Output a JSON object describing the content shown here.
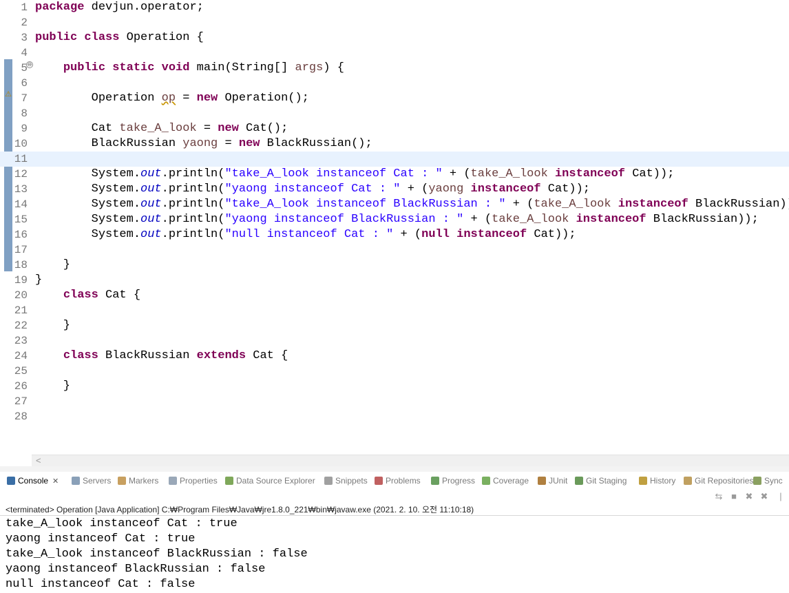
{
  "editor": {
    "lines": [
      {
        "n": "1",
        "html": "<span class=\"kw\">package</span> devjun.operator;"
      },
      {
        "n": "2",
        "html": ""
      },
      {
        "n": "3",
        "html": "<span class=\"kw\">public</span> <span class=\"kw\">class</span> Operation {"
      },
      {
        "n": "4",
        "html": ""
      },
      {
        "n": "5",
        "html": "    <span class=\"kw\">public</span> <span class=\"kw\">static</span> <span class=\"kw\">void</span> main(String[] <span class=\"var\">args</span>) {"
      },
      {
        "n": "6",
        "html": ""
      },
      {
        "n": "7",
        "html": "        Operation <span class=\"var warnu\">op</span> = <span class=\"kw\">new</span> Operation();"
      },
      {
        "n": "8",
        "html": ""
      },
      {
        "n": "9",
        "html": "        Cat <span class=\"var\">take_A_look</span> = <span class=\"kw\">new</span> Cat();"
      },
      {
        "n": "10",
        "html": "        BlackRussian <span class=\"var\">yaong</span> = <span class=\"kw\">new</span> BlackRussian();"
      },
      {
        "n": "11",
        "html": ""
      },
      {
        "n": "12",
        "html": "        System.<span class=\"fld\">out</span>.println(<span class=\"str\">\"take_A_look instanceof Cat : \"</span> + (<span class=\"var\">take_A_look</span> <span class=\"kw\">instanceof</span> Cat));"
      },
      {
        "n": "13",
        "html": "        System.<span class=\"fld\">out</span>.println(<span class=\"str\">\"yaong instanceof Cat : \"</span> + (<span class=\"var\">yaong</span> <span class=\"kw\">instanceof</span> Cat));"
      },
      {
        "n": "14",
        "html": "        System.<span class=\"fld\">out</span>.println(<span class=\"str\">\"take_A_look instanceof BlackRussian : \"</span> + (<span class=\"var\">take_A_look</span> <span class=\"kw\">instanceof</span> BlackRussian));"
      },
      {
        "n": "15",
        "html": "        System.<span class=\"fld\">out</span>.println(<span class=\"str\">\"yaong instanceof BlackRussian : \"</span> + (<span class=\"var\">take_A_look</span> <span class=\"kw\">instanceof</span> BlackRussian));"
      },
      {
        "n": "16",
        "html": "        System.<span class=\"fld\">out</span>.println(<span class=\"str\">\"null instanceof Cat : \"</span> + (<span class=\"kw\">null</span> <span class=\"kw\">instanceof</span> Cat));"
      },
      {
        "n": "17",
        "html": ""
      },
      {
        "n": "18",
        "html": "    }"
      },
      {
        "n": "19",
        "html": "}"
      },
      {
        "n": "20",
        "html": "    <span class=\"kw\">class</span> Cat {"
      },
      {
        "n": "21",
        "html": ""
      },
      {
        "n": "22",
        "html": "    }"
      },
      {
        "n": "23",
        "html": ""
      },
      {
        "n": "24",
        "html": "    <span class=\"kw\">class</span> BlackRussian <span class=\"kw\">extends</span> Cat {"
      },
      {
        "n": "25",
        "html": ""
      },
      {
        "n": "26",
        "html": "    }"
      },
      {
        "n": "27",
        "html": ""
      },
      {
        "n": "28",
        "html": ""
      }
    ],
    "current_line": "11",
    "fold_symbol": "⊖",
    "warning_symbol": "⚠",
    "scroll_left_symbol": "<"
  },
  "tabs": [
    {
      "label": "Console",
      "icon": "console-icon",
      "color": "#3a6ea5",
      "active": true,
      "close": "✕"
    },
    {
      "label": "Servers",
      "icon": "servers-icon",
      "color": "#8aa0b8"
    },
    {
      "label": "Markers",
      "icon": "markers-icon",
      "color": "#c8a060"
    },
    {
      "label": "Properties",
      "icon": "properties-icon",
      "color": "#9aa8b8"
    },
    {
      "label": "Data Source Explorer",
      "icon": "data-source-icon",
      "color": "#7fa85a"
    },
    {
      "label": "Snippets",
      "icon": "snippets-icon",
      "color": "#a0a0a0"
    },
    {
      "label": "Problems",
      "icon": "problems-icon",
      "color": "#c06060"
    },
    {
      "label": "Progress",
      "icon": "progress-icon",
      "color": "#6aa060"
    },
    {
      "label": "Coverage",
      "icon": "coverage-icon",
      "color": "#7ab060"
    },
    {
      "label": "JUnit",
      "icon": "junit-icon",
      "color": "#b08040"
    },
    {
      "label": "Git Staging",
      "icon": "git-staging-icon",
      "color": "#6a9a5a"
    },
    {
      "label": "History",
      "icon": "history-icon",
      "color": "#c0a040"
    },
    {
      "label": "Git Repositories",
      "icon": "git-repositories-icon",
      "color": "#c0a060"
    },
    {
      "label": "Sync",
      "icon": "sync-icon",
      "color": "#8aa060"
    }
  ],
  "toolbar": [
    {
      "icon": "disconnect-icon",
      "glyph": "⇆"
    },
    {
      "icon": "terminate-icon",
      "glyph": "■"
    },
    {
      "icon": "remove-launch-icon",
      "glyph": "✖"
    },
    {
      "icon": "remove-all-icon",
      "glyph": "✖"
    },
    {
      "icon": "separator-icon",
      "glyph": "|"
    }
  ],
  "console": {
    "description": "<terminated> Operation [Java Application] C:₩Program Files₩Java₩jre1.8.0_221₩bin₩javaw.exe (2021. 2. 10. 오전 11:10:18)",
    "output": [
      "take_A_look instanceof Cat : true",
      "yaong instanceof Cat : true",
      "take_A_look instanceof BlackRussian : false",
      "yaong instanceof BlackRussian : false",
      "null instanceof Cat : false"
    ]
  },
  "colors": {
    "keyword": "#7f0055",
    "string": "#2a00ff",
    "field": "#0000c0",
    "current_line": "#e8f2fe"
  }
}
